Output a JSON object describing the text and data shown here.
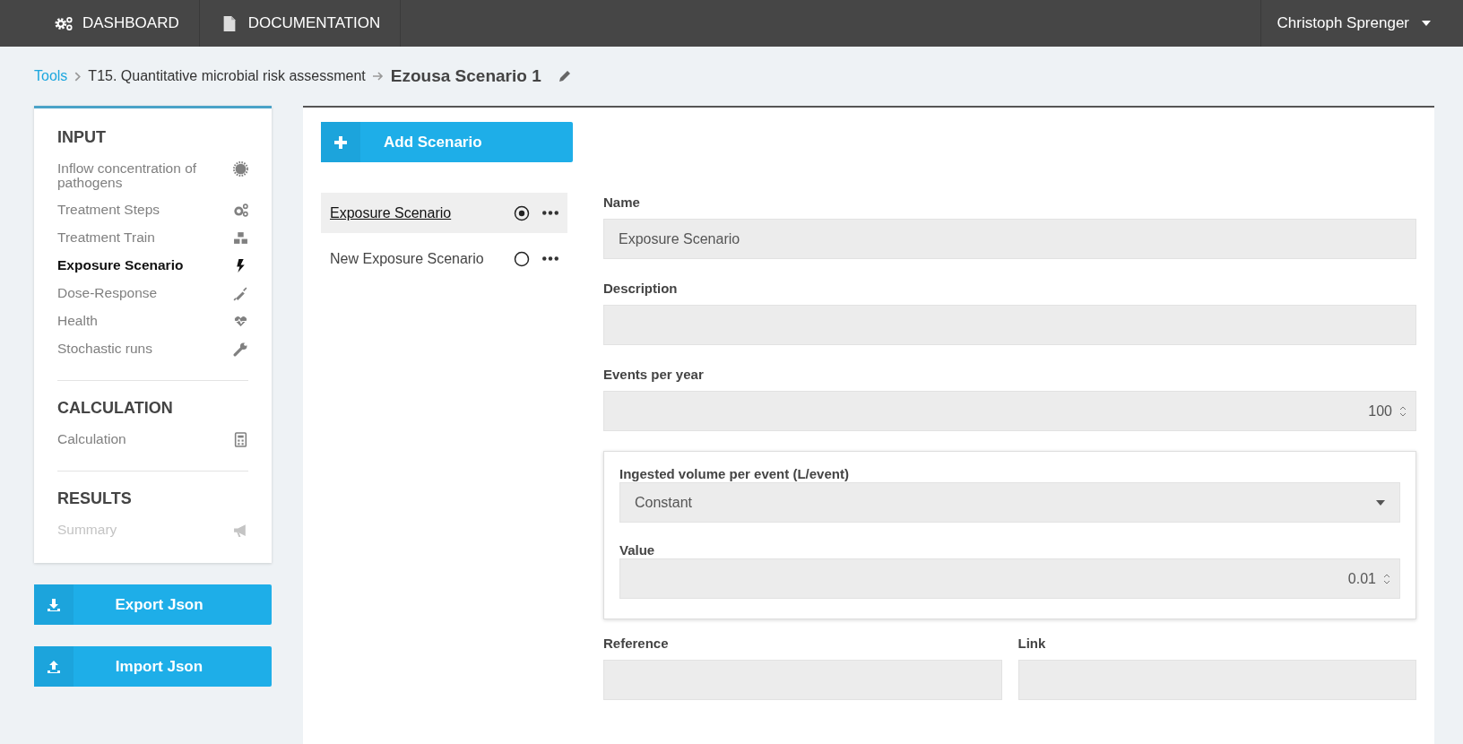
{
  "topnav": {
    "items": [
      {
        "label": "DASHBOARD"
      },
      {
        "label": "DOCUMENTATION"
      }
    ],
    "user": "Christoph Sprenger"
  },
  "breadcrumb": {
    "root": "Tools",
    "parent": "T15. Quantitative microbial risk assessment",
    "current": "Ezousa Scenario 1"
  },
  "sidebar": {
    "sections": [
      {
        "title": "INPUT",
        "items": [
          {
            "label": "Inflow concentration of pathogens",
            "selected": false,
            "disabled": false
          },
          {
            "label": "Treatment Steps",
            "selected": false,
            "disabled": false
          },
          {
            "label": "Treatment Train",
            "selected": false,
            "disabled": false
          },
          {
            "label": "Exposure Scenario",
            "selected": true,
            "disabled": false
          },
          {
            "label": "Dose-Response",
            "selected": false,
            "disabled": false
          },
          {
            "label": "Health",
            "selected": false,
            "disabled": false
          },
          {
            "label": "Stochastic runs",
            "selected": false,
            "disabled": false
          }
        ]
      },
      {
        "title": "CALCULATION",
        "items": [
          {
            "label": "Calculation",
            "selected": false,
            "disabled": false
          }
        ]
      },
      {
        "title": "RESULTS",
        "items": [
          {
            "label": "Summary",
            "selected": false,
            "disabled": true
          }
        ]
      }
    ]
  },
  "actions": [
    {
      "label": "Export Json"
    },
    {
      "label": "Import Json"
    }
  ],
  "add_button": "Add Scenario",
  "scenarios": [
    {
      "name": "Exposure Scenario",
      "selected": true
    },
    {
      "name": "New Exposure Scenario",
      "selected": false
    }
  ],
  "form": {
    "name": {
      "label": "Name",
      "value": "Exposure Scenario"
    },
    "description": {
      "label": "Description"
    },
    "events": {
      "label": "Events per year",
      "value": "100"
    },
    "ingested": {
      "label": "Ingested volume per event (L/event)",
      "distribution": "Constant",
      "value_label": "Value",
      "value": "0.01"
    },
    "reference": {
      "label": "Reference"
    },
    "link": {
      "label": "Link"
    }
  }
}
